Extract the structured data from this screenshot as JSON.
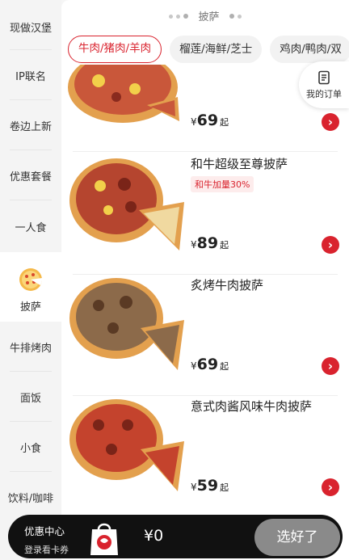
{
  "sidebar": {
    "items": [
      {
        "label": "现做汉堡"
      },
      {
        "label": "IP联名"
      },
      {
        "label": "卷边上新"
      },
      {
        "label": "优惠套餐"
      },
      {
        "label": "一人食"
      },
      {
        "label": "披萨"
      },
      {
        "label": "牛排烤肉"
      },
      {
        "label": "面饭"
      },
      {
        "label": "小食"
      },
      {
        "label": "饮料/咖啡"
      }
    ],
    "active_index": 5
  },
  "header": {
    "title": "披萨"
  },
  "chips": [
    {
      "label": "牛肉/猪肉/羊肉",
      "active": true
    },
    {
      "label": "榴莲/海鲜/芝士",
      "active": false
    },
    {
      "label": "鸡肉/鸭肉/双",
      "active": false
    }
  ],
  "order_button": {
    "label": "我的订单",
    "icon": "order-list-icon"
  },
  "products": [
    {
      "name": "",
      "tag": "",
      "currency": "¥",
      "price": "69",
      "suffix": "起"
    },
    {
      "name": "和牛超级至尊披萨",
      "tag": "和牛加量30%",
      "currency": "¥",
      "price": "89",
      "suffix": "起"
    },
    {
      "name": "炙烤牛肉披萨",
      "tag": "",
      "currency": "¥",
      "price": "69",
      "suffix": "起"
    },
    {
      "name": "意式肉酱风味牛肉披萨",
      "tag": "",
      "currency": "¥",
      "price": "59",
      "suffix": "起"
    }
  ],
  "bottom_bar": {
    "promo_title": "优惠中心",
    "promo_sub": "登录看卡券",
    "total": "¥0",
    "checkout_label": "选好了"
  },
  "colors": {
    "accent": "#d9232e",
    "checkout_bg": "#8a8a8a",
    "bar_bg": "#111111"
  }
}
